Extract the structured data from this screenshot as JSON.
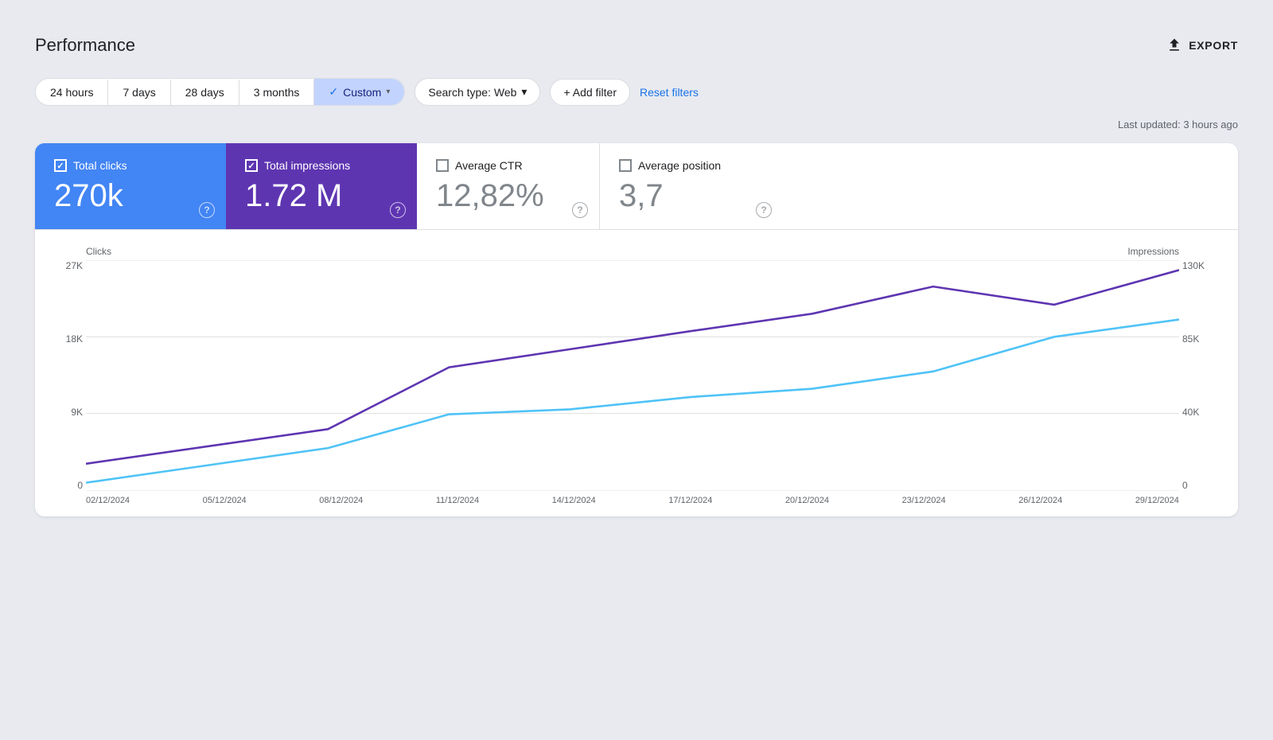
{
  "header": {
    "title": "Performance",
    "export_label": "EXPORT"
  },
  "filters": {
    "time_options": [
      {
        "label": "24 hours",
        "active": false
      },
      {
        "label": "7 days",
        "active": false
      },
      {
        "label": "28 days",
        "active": false
      },
      {
        "label": "3 months",
        "active": false
      },
      {
        "label": "Custom",
        "active": true
      }
    ],
    "search_type_label": "Search type: Web",
    "add_filter_label": "+ Add filter",
    "reset_label": "Reset filters"
  },
  "last_updated": "Last updated: 3 hours ago",
  "metrics": [
    {
      "id": "total-clicks",
      "label": "Total clicks",
      "value": "270k",
      "checked": true,
      "style": "blue"
    },
    {
      "id": "total-impressions",
      "label": "Total impressions",
      "value": "1.72 M",
      "checked": true,
      "style": "purple"
    },
    {
      "id": "avg-ctr",
      "label": "Average CTR",
      "value": "12,82%",
      "checked": false,
      "style": "white"
    },
    {
      "id": "avg-position",
      "label": "Average position",
      "value": "3,7",
      "checked": false,
      "style": "white"
    }
  ],
  "chart": {
    "left_label": "Clicks",
    "right_label": "Impressions",
    "y_left": [
      "27K",
      "18K",
      "9K",
      "0"
    ],
    "y_right": [
      "130K",
      "85K",
      "40K",
      "0"
    ],
    "x_labels": [
      "02/12/2024",
      "05/12/2024",
      "08/12/2024",
      "11/12/2024",
      "14/12/2024",
      "17/12/2024",
      "20/12/2024",
      "23/12/2024",
      "26/12/2024",
      "29/12/2024"
    ],
    "clicks_color": "#4fc3f7",
    "impressions_color": "#5e35b1"
  }
}
